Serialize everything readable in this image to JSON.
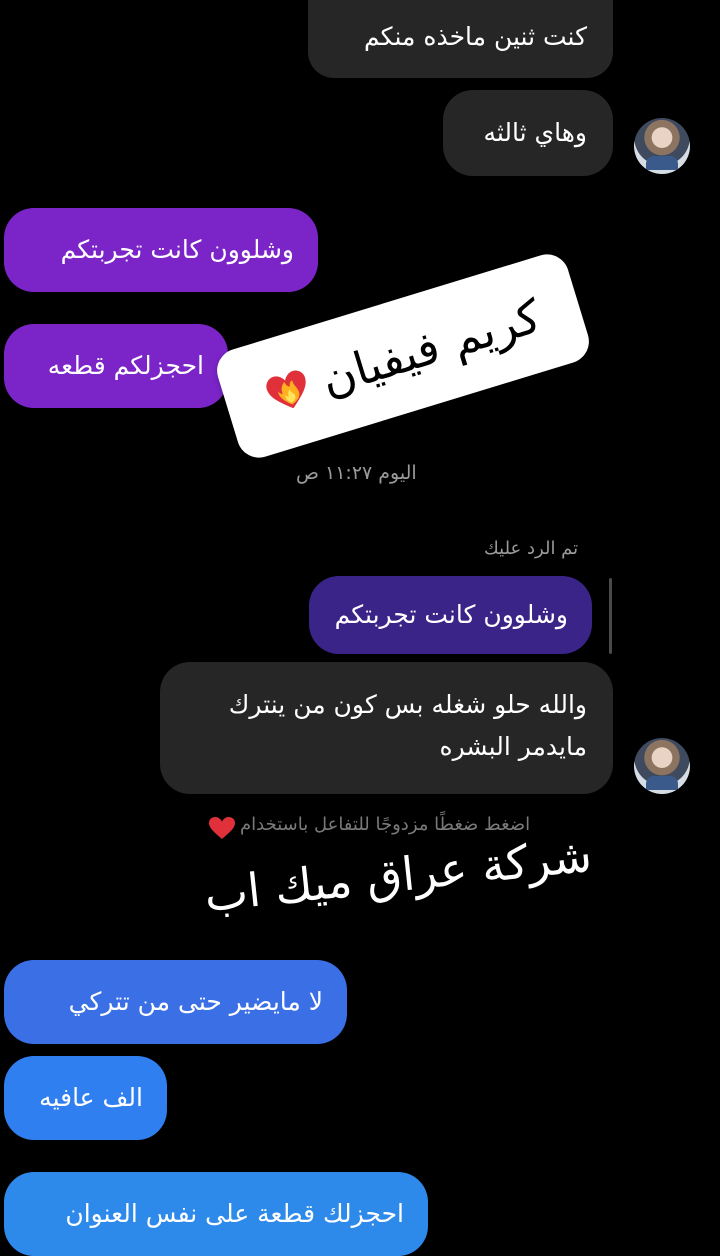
{
  "messages": {
    "m1": "كنت ثنين ماخذه منكم",
    "m2": "وهاي ثالثه",
    "m3": "وشلوون كانت تجربتكم",
    "m4": "احجزلكم قطعه",
    "reply_quote": "وشلوون كانت تجربتكم",
    "m5": "والله حلو شغله بس كون من ينترك\nمايدمر البشره",
    "m6": "لا مايضير حتى من تتركي",
    "m7": "الف عافيه",
    "m8": "احجزلك قطعة على نفس العنوان"
  },
  "timestamp": "اليوم ١١:٢٧ ص",
  "reply_label": "تم الرد عليك",
  "reaction_hint": "اضغط ضغطًا مزدوجًا للتفاعل باستخدام",
  "sticker": {
    "text": "كريم فيفيان",
    "icon": "burning-heart-icon"
  },
  "overlay_text": "شركة عراق ميك اب",
  "colors": {
    "background": "#000000",
    "incoming_bubble": "#262626",
    "outgoing_purple": "#7b24c8",
    "outgoing_blue": "#3a6fe6",
    "heart_red": "#e0313a"
  }
}
